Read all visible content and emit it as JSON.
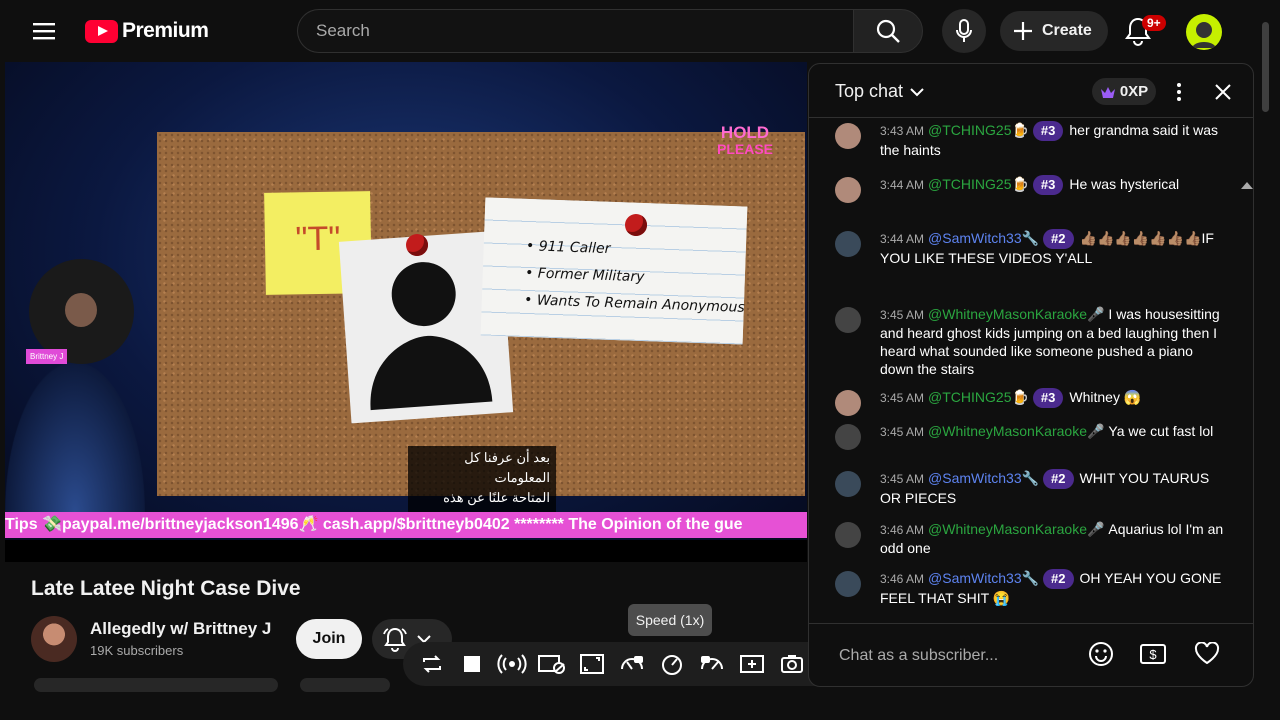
{
  "header": {
    "brand": "Premium",
    "search_placeholder": "Search",
    "create_label": "Create",
    "notification_count": "9+"
  },
  "video": {
    "sticky_note": "\"T\"",
    "notes": [
      "911 Caller",
      "Former Military",
      "Wants To Remain Anonymous"
    ],
    "hold_line1": "HOLD",
    "hold_line2": "PLEASE",
    "subtitle_line1": "بعد أن عرفنا كل المعلومات",
    "subtitle_line2": "المتاحة علنًا عن هذه القضية،",
    "cam_tag": "Brittney J",
    "ticker": "Tips 💸paypal.me/brittneyjackson1496🥂 cash.app/$brittneyb0402 ******** The Opinion of the gue"
  },
  "meta": {
    "title": "Late Latee Night Case Dive",
    "channel": "Allegedly w/ Brittney J",
    "subscribers": "19K subscribers",
    "join_label": "Join",
    "speed_tooltip": "Speed (1x)"
  },
  "chat": {
    "mode": "Top chat",
    "xp": "0XP",
    "input_placeholder": "Chat as a subscriber...",
    "messages": [
      {
        "time": "3:43 AM",
        "author": "@TCHING25🍺",
        "rank": "#3",
        "text": "her grandma said it was the haints"
      },
      {
        "time": "3:44 AM",
        "author": "@TCHING25🍺",
        "rank": "#3",
        "text": "He was hysterical"
      },
      {
        "time": "3:44 AM",
        "author": "@SamWitch33🔧",
        "rank": "#2",
        "text": "👍🏽👍🏽👍🏽👍🏽👍🏽👍🏽👍🏽IF YOU LIKE THESE VIDEOS Y'ALL"
      },
      {
        "time": "3:45 AM",
        "author": "@WhitneyMasonKaraoke🎤",
        "rank": "",
        "text": "I was housesitting and heard ghost kids jumping on a bed laughing then I heard what sounded like someone pushed a piano down the stairs"
      },
      {
        "time": "3:45 AM",
        "author": "@TCHING25🍺",
        "rank": "#3",
        "text": "Whitney 😱"
      },
      {
        "time": "3:45 AM",
        "author": "@WhitneyMasonKaraoke🎤",
        "rank": "",
        "text": "Ya we cut fast lol"
      },
      {
        "time": "3:45 AM",
        "author": "@SamWitch33🔧",
        "rank": "#2",
        "text": "WHIT YOU TAURUS OR PIECES"
      },
      {
        "time": "3:46 AM",
        "author": "@WhitneyMasonKaraoke🎤",
        "rank": "",
        "text": "Aquarius lol I'm an odd one"
      },
      {
        "time": "3:46 AM",
        "author": "@SamWitch33🔧",
        "rank": "#2",
        "text": "OH YEAH YOU GONE FEEL THAT SHIT 😭"
      }
    ]
  },
  "colors": {
    "accent_red": "#ff0033",
    "author_green": "#2ba640",
    "author_blue": "#5e84f1",
    "ticker_pink": "#e651d5"
  }
}
